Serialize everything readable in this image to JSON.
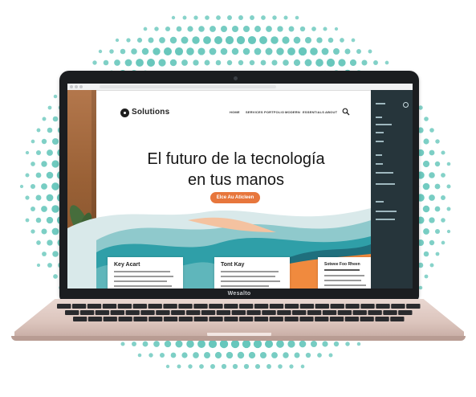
{
  "laptop": {
    "brand_label": "Wesalto"
  },
  "site": {
    "logo_text": "Solutions",
    "nav": [
      "HOME",
      "SERVICES",
      "PORTFOLIO",
      "MODERN",
      "ESSENTIALS",
      "ABOUT"
    ],
    "hero_title_line1": "El futuro de la tecnología",
    "hero_title_line2": "en tus manos",
    "cta_label": "Elce Au Aticleen",
    "cards": [
      {
        "title": "Key Acart"
      },
      {
        "title": "Tont Kay"
      },
      {
        "title": "Sotwee Foo Rheen"
      }
    ]
  },
  "colors": {
    "accent": "#e7763c",
    "teal": "#2f9fa8",
    "panel": "#26353b",
    "dots": "#5fc4b8"
  }
}
